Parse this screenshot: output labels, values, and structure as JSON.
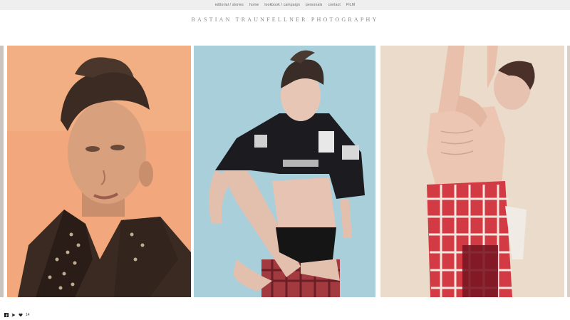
{
  "nav": {
    "items": [
      "editorial / stories",
      "home",
      "lookbook / campaign",
      "personals",
      "contact",
      "FILM"
    ]
  },
  "brand": {
    "title": "BASTIAN TRAUNFELLNER PHOTOGRAPHY"
  },
  "gallery": {
    "photos": [
      {
        "alt": "partial-edge-photo"
      },
      {
        "alt": "portrait-studded-leather-jacket",
        "bg": "#f2a77c"
      },
      {
        "alt": "seated-model-black-hoodie",
        "bg": "#a9cfdb"
      },
      {
        "alt": "model-arm-raised-plaid-shorts",
        "bg": "#eadbcb"
      },
      {
        "alt": "partial-edge-photo"
      }
    ]
  },
  "footer": {
    "icons": [
      "facebook-icon",
      "share-icon",
      "heart-icon"
    ],
    "like_count": "14"
  }
}
